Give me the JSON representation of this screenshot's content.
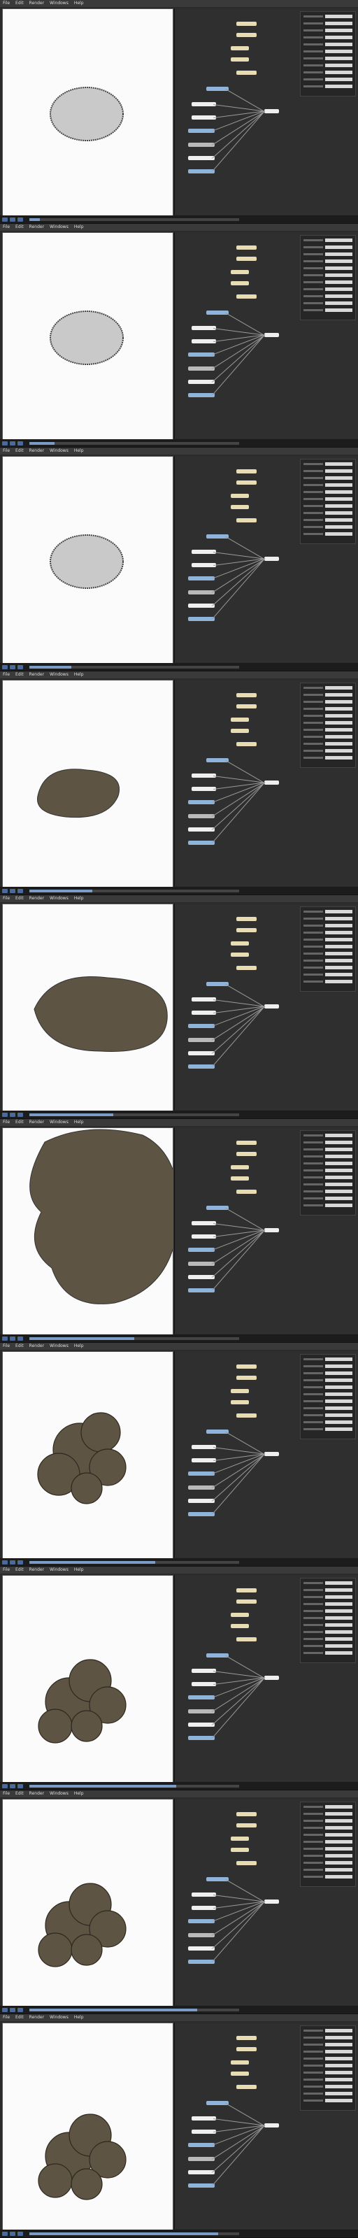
{
  "app": {
    "menu": [
      "File",
      "Edit",
      "Render",
      "Windows",
      "Help"
    ]
  },
  "colors": {
    "viewport_bg": "#fbfbfb",
    "sphere_grey": "#c9c9c9",
    "clay_brown": "#5e5444",
    "accent_blue": "#7a9cc6"
  },
  "frames": [
    {
      "mesh": "ellipse-grey",
      "progress": 0.05
    },
    {
      "mesh": "ellipse-grey",
      "progress": 0.12
    },
    {
      "mesh": "ellipse-grey",
      "progress": 0.2
    },
    {
      "mesh": "blob-brown-small",
      "progress": 0.3
    },
    {
      "mesh": "blob-brown-large",
      "progress": 0.4
    },
    {
      "mesh": "blob-brown-zoom",
      "progress": 0.5
    },
    {
      "mesh": "cluster-brown",
      "progress": 0.6
    },
    {
      "mesh": "cluster-brown-2",
      "progress": 0.7
    },
    {
      "mesh": "cluster-brown-2",
      "progress": 0.8
    },
    {
      "mesh": "cluster-brown-3",
      "progress": 0.9
    }
  ]
}
